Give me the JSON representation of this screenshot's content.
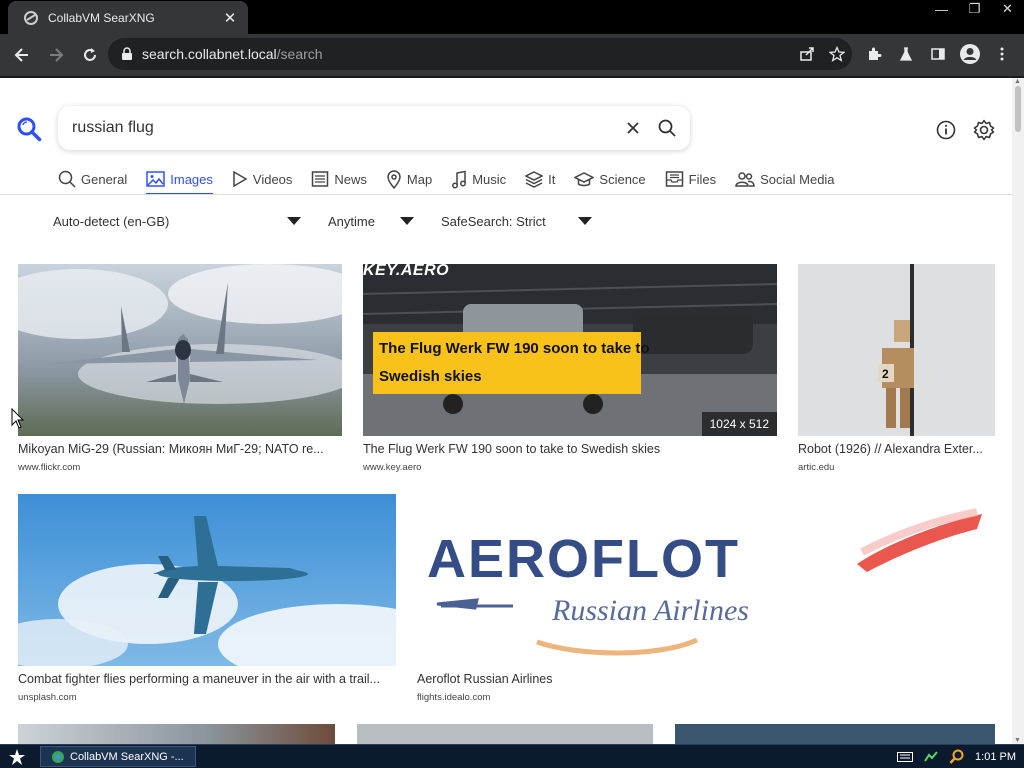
{
  "browser": {
    "tab_title": "CollabVM SearXNG",
    "url_host": "search.collabnet.local",
    "url_path": "/search"
  },
  "search": {
    "query": "russian flug"
  },
  "categories": [
    {
      "label": "General",
      "icon": "search-icon",
      "active": false
    },
    {
      "label": "Images",
      "icon": "image-icon",
      "active": true
    },
    {
      "label": "Videos",
      "icon": "play-icon",
      "active": false
    },
    {
      "label": "News",
      "icon": "newspaper-icon",
      "active": false
    },
    {
      "label": "Map",
      "icon": "map-pin-icon",
      "active": false
    },
    {
      "label": "Music",
      "icon": "music-note-icon",
      "active": false
    },
    {
      "label": "It",
      "icon": "layers-icon",
      "active": false
    },
    {
      "label": "Science",
      "icon": "graduation-cap-icon",
      "active": false
    },
    {
      "label": "Files",
      "icon": "inbox-icon",
      "active": false
    },
    {
      "label": "Social Media",
      "icon": "people-icon",
      "active": false
    }
  ],
  "filters": {
    "language": "Auto-detect (en-GB)",
    "time": "Anytime",
    "safesearch": "SafeSearch: Strict"
  },
  "results": [
    {
      "title": "Mikoyan MiG-29 (Russian: Микоян МиГ-29; NATO re...",
      "source": "www.flickr.com"
    },
    {
      "title": "The Flug Werk FW 190 soon to take to Swedish skies",
      "source": "www.key.aero",
      "dimensions": "1024 x 512",
      "thumb_brand": "KEY.AERO",
      "thumb_headline_1": "The Flug Werk FW 190 soon to take to",
      "thumb_headline_2": "Swedish skies"
    },
    {
      "title": "Robot (1926) // Alexandra Exter...",
      "source": "artic.edu"
    },
    {
      "title": "Combat fighter flies performing a maneuver in the air with a trail...",
      "source": "unsplash.com"
    },
    {
      "title": "Aeroflot Russian Airlines",
      "source": "flights.idealo.com",
      "thumb_brand": "AEROFLOT",
      "thumb_tagline": "Russian Airlines"
    }
  ],
  "taskbar": {
    "task_label": "CollabVM SearXNG -...",
    "clock": "1:01 PM"
  },
  "colors": {
    "accent": "#3050ff",
    "key_aero_yellow": "#f9c21a",
    "aeroflot_blue": "#1f3a7a"
  }
}
